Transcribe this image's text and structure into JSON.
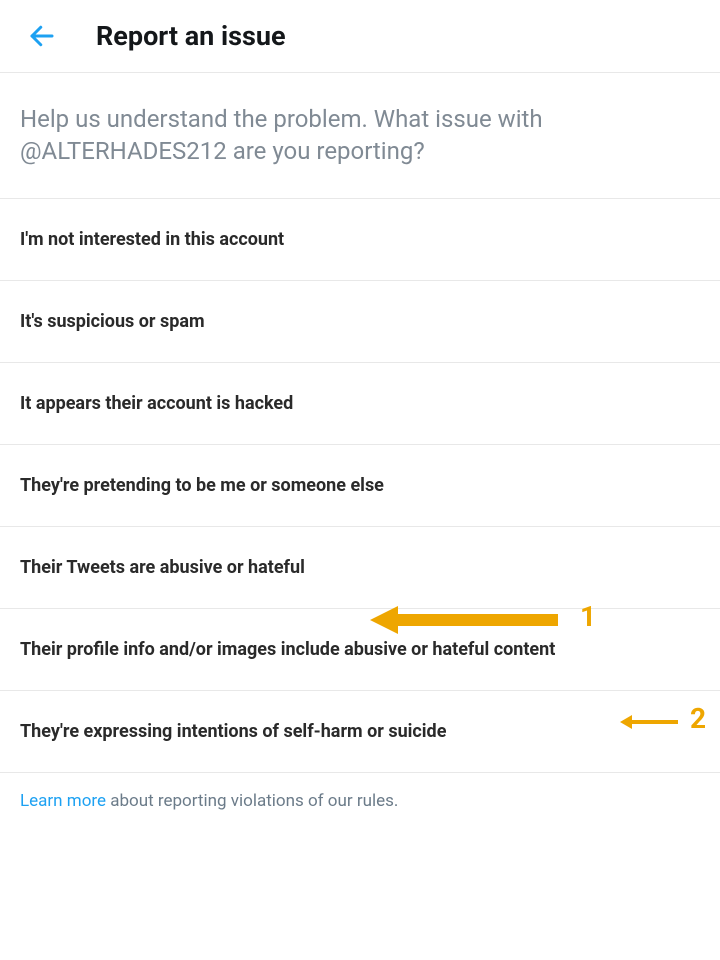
{
  "header": {
    "title": "Report an issue"
  },
  "prompt": "Help us understand the problem. What issue with @ALTERHADES212 are you reporting?",
  "options": [
    "I'm not interested in this account",
    "It's suspicious or spam",
    "It appears their account is hacked",
    "They're pretending to be me or someone else",
    "Their Tweets are abusive or hateful",
    "Their profile info and/or images include abusive or hateful content",
    "They're expressing intentions of self-harm or suicide"
  ],
  "footer": {
    "learn_more": "Learn more",
    "rest": " about reporting violations of our rules."
  },
  "annotations": {
    "label1": "1",
    "label2": "2"
  },
  "colors": {
    "accent": "#1da1f2",
    "arrow": "#eea600"
  }
}
